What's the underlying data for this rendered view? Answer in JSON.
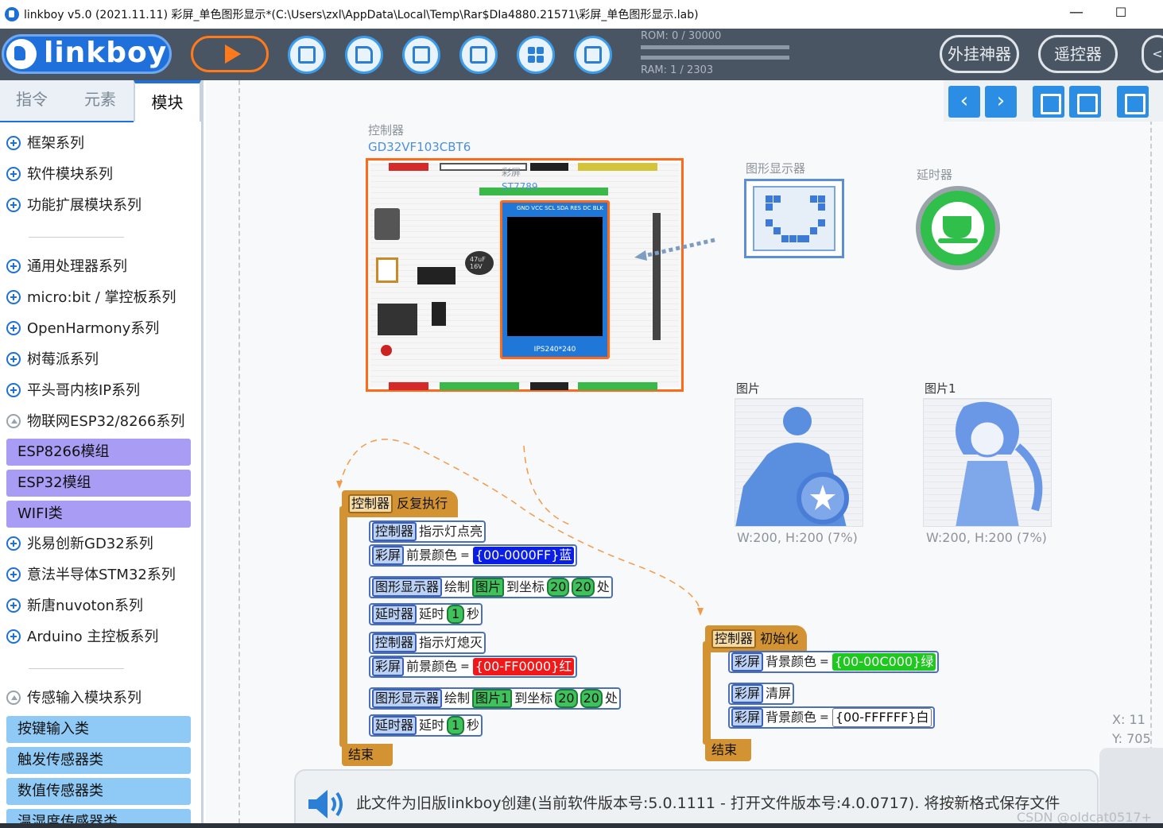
{
  "window": {
    "title": "linkboy v5.0 (2021.11.11) 彩屏_单色图形显示*(C:\\Users\\zxl\\AppData\\Local\\Temp\\Rar$DIa4880.21571\\彩屏_单色图形显示.lab)",
    "minimize": "—",
    "maximize": "☐"
  },
  "toolbar": {
    "logo": "linkboy",
    "rom": "ROM: 0 / 30000",
    "ram": "RAM: 1 / 2303",
    "plugin_label": "外挂神器",
    "remote_label": "遥控器"
  },
  "sidebar": {
    "tabs": [
      "指令",
      "元素",
      "模块"
    ],
    "active_tab": "模块",
    "group1": [
      "框架系列",
      "软件模块系列",
      "功能扩展模块系列"
    ],
    "group2": [
      "通用处理器系列",
      "micro:bit / 掌控板系列",
      "OpenHarmony系列",
      "树莓派系列",
      "平头哥内核IP系列"
    ],
    "expanded1": "物联网ESP32/8266系列",
    "expanded1_items": [
      "ESP8266模组",
      "ESP32模组",
      "WIFI类"
    ],
    "group3": [
      "兆易创新GD32系列",
      "意法半导体STM32系列",
      "新唐nuvoton系列",
      "Arduino 主控板系列"
    ],
    "expanded2": "传感输入模块系列",
    "expanded2_items": [
      "按键输入类",
      "触发传感器类",
      "数值传感器类",
      "温湿度传感器类"
    ]
  },
  "canvas": {
    "controller_label": "控制器",
    "controller_model": "GD32VF103CBT6",
    "lcd_label": "彩屏",
    "lcd_model": "ST7789",
    "lcd_pins": "GND VCC SCL SDA RES DC BLK",
    "lcd_caption": "IPS240*240",
    "cap_text": "47uF\n16V",
    "display_label": "图形显示器",
    "timer_label": "延时器",
    "image1_label": "图片",
    "image2_label": "图片1",
    "image1_info": "W:200, H:200 (7%)",
    "image2_info": "W:200, H:200 (7%)",
    "coord_x": "X: 11",
    "coord_y": "Y: 705"
  },
  "loop_event": {
    "tag": "控制器",
    "title": "反复执行",
    "end": "结束",
    "lines": [
      {
        "tag": "控制器",
        "text": "指示灯点亮"
      },
      {
        "tag": "彩屏",
        "text": "前景颜色",
        "eq": "=",
        "value": "{00-0000FF}蓝",
        "color": "#0b1ee6",
        "fg": "#ffffff"
      },
      {
        "tag": "图形显示器",
        "text": "绘制",
        "img": "图片",
        "mid": "到坐标",
        "x": "20",
        "y": "20",
        "end": "处"
      },
      {
        "tag": "延时器",
        "text": "延时",
        "num": "1",
        "unit": "秒"
      },
      {
        "tag": "控制器",
        "text": "指示灯熄灭"
      },
      {
        "tag": "彩屏",
        "text": "前景颜色",
        "eq": "=",
        "value": "{00-FF0000}红",
        "color": "#f01818",
        "fg": "#ffffff"
      },
      {
        "tag": "图形显示器",
        "text": "绘制",
        "img": "图片1",
        "mid": "到坐标",
        "x": "20",
        "y": "20",
        "end": "处"
      },
      {
        "tag": "延时器",
        "text": "延时",
        "num": "1",
        "unit": "秒"
      }
    ]
  },
  "init_event": {
    "tag": "控制器",
    "title": "初始化",
    "end": "结束",
    "lines": [
      {
        "tag": "彩屏",
        "text": "背景颜色",
        "eq": "=",
        "value": "{00-00C000}绿",
        "color": "#1ec81e",
        "fg": "#ffffff"
      },
      {
        "tag": "彩屏",
        "text": "清屏"
      },
      {
        "tag": "彩屏",
        "text": "背景颜色",
        "eq": "=",
        "value": "{00-FFFFFF}白",
        "color": "#ffffff",
        "fg": "#111111"
      }
    ]
  },
  "notice": "此文件为旧版linkboy创建(当前软件版本号:5.0.1111 - 打开文件版本号:4.0.0717). 将按新格式保存文件",
  "watermark": "CSDN @oldcat0517+"
}
